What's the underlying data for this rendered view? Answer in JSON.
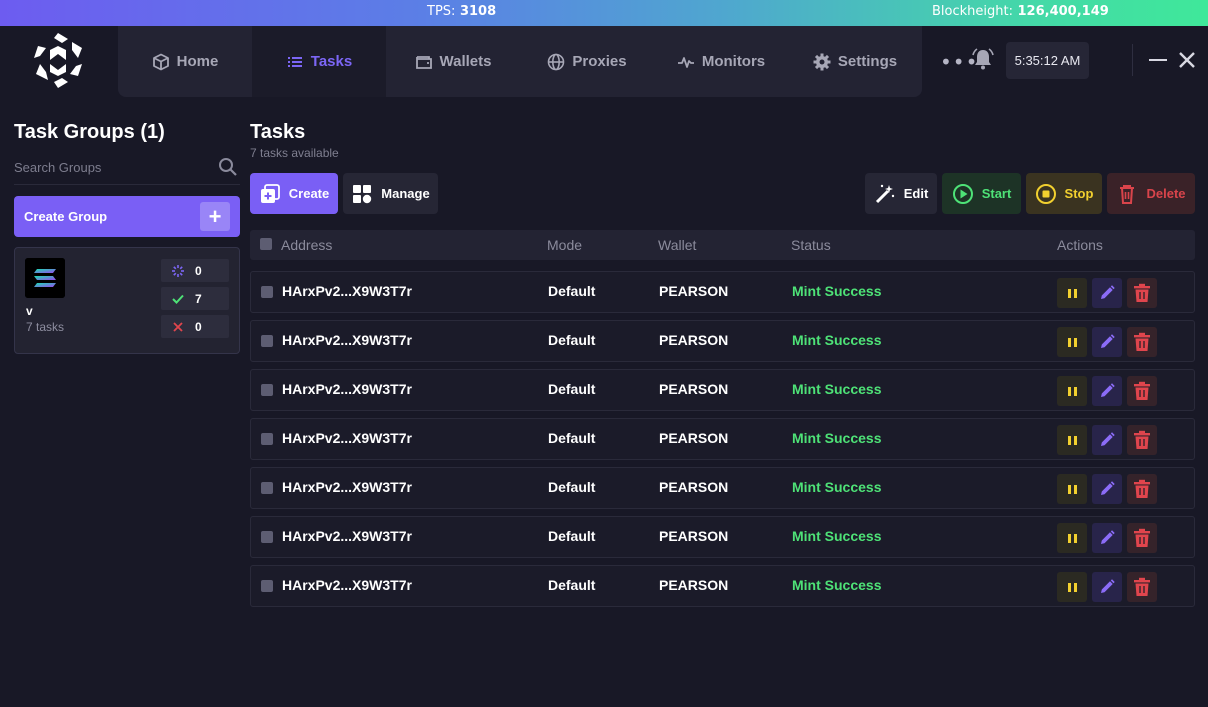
{
  "ticker": {
    "tps_label": "TPS:",
    "tps_value": "3108",
    "blockheight_label": "Blockheight:",
    "blockheight_value": "126,400,149"
  },
  "nav": {
    "items": [
      {
        "label": "Home",
        "icon": "cube-icon"
      },
      {
        "label": "Tasks",
        "icon": "list-icon"
      },
      {
        "label": "Wallets",
        "icon": "wallet-icon"
      },
      {
        "label": "Proxies",
        "icon": "globe-icon"
      },
      {
        "label": "Monitors",
        "icon": "pulse-icon"
      },
      {
        "label": "Settings",
        "icon": "gear-icon"
      }
    ],
    "active": "Tasks",
    "more": "•••",
    "clock": "5:35:12 AM"
  },
  "sidebar": {
    "title": "Task Groups (1)",
    "search_placeholder": "Search Groups",
    "create_group_label": "Create Group",
    "create_group_plus": "+",
    "group": {
      "name": "v",
      "count_label": "7 tasks",
      "stats": {
        "running": "0",
        "success": "7",
        "failed": "0"
      }
    }
  },
  "main": {
    "title": "Tasks",
    "subtitle": "7 tasks available",
    "toolbar": {
      "create": "Create",
      "manage": "Manage",
      "edit": "Edit",
      "start": "Start",
      "stop": "Stop",
      "delete": "Delete"
    },
    "columns": {
      "address": "Address",
      "mode": "Mode",
      "wallet": "Wallet",
      "status": "Status",
      "actions": "Actions"
    },
    "rows": [
      {
        "address": "HArxPv2...X9W3T7r",
        "mode": "Default",
        "wallet": "PEARSON",
        "status": "Mint Success"
      },
      {
        "address": "HArxPv2...X9W3T7r",
        "mode": "Default",
        "wallet": "PEARSON",
        "status": "Mint Success"
      },
      {
        "address": "HArxPv2...X9W3T7r",
        "mode": "Default",
        "wallet": "PEARSON",
        "status": "Mint Success"
      },
      {
        "address": "HArxPv2...X9W3T7r",
        "mode": "Default",
        "wallet": "PEARSON",
        "status": "Mint Success"
      },
      {
        "address": "HArxPv2...X9W3T7r",
        "mode": "Default",
        "wallet": "PEARSON",
        "status": "Mint Success"
      },
      {
        "address": "HArxPv2...X9W3T7r",
        "mode": "Default",
        "wallet": "PEARSON",
        "status": "Mint Success"
      },
      {
        "address": "HArxPv2...X9W3T7r",
        "mode": "Default",
        "wallet": "PEARSON",
        "status": "Mint Success"
      }
    ]
  },
  "colors": {
    "accent": "#7a5ff5",
    "success": "#4ee277",
    "warning": "#f2d02f",
    "danger": "#e0454d",
    "background": "#181826"
  }
}
